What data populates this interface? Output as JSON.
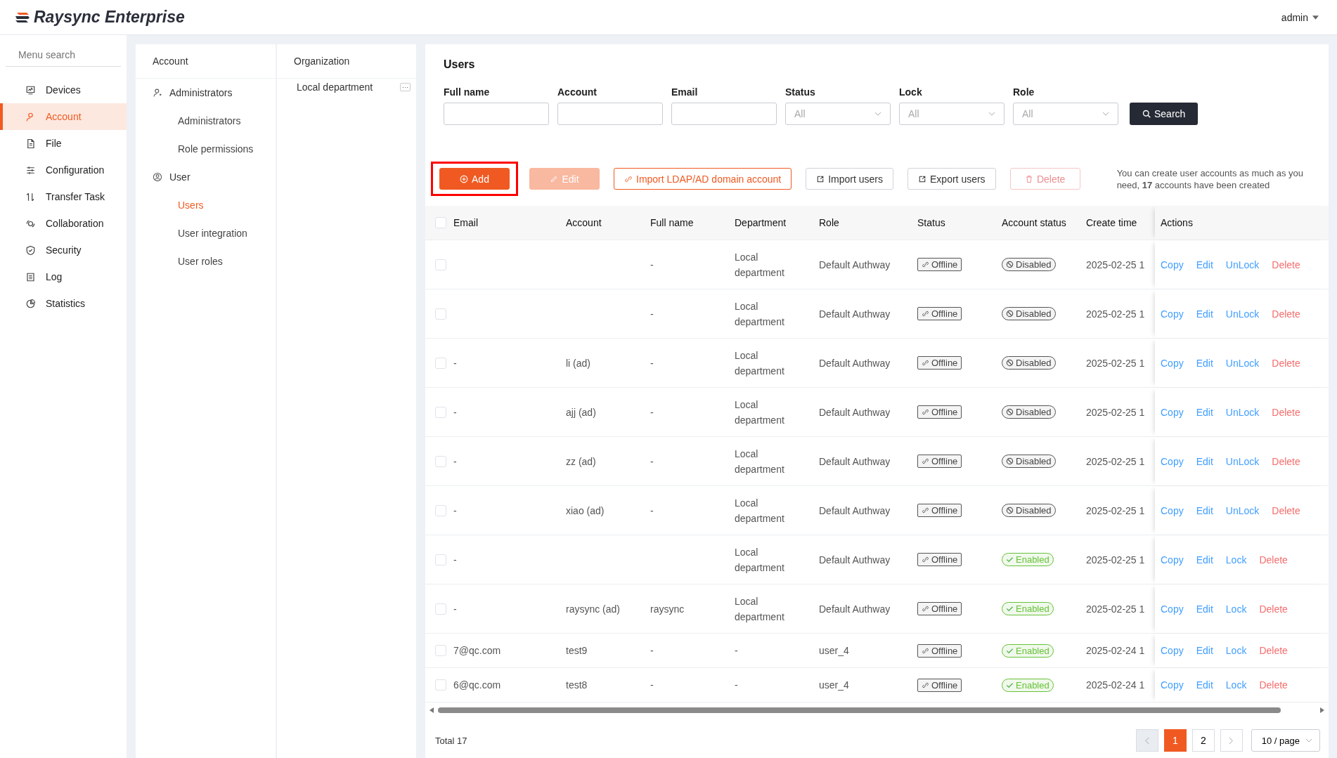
{
  "header": {
    "product": "Raysync Enterprise",
    "user": "admin"
  },
  "sidebar": {
    "search": {
      "placeholder": "Menu search"
    },
    "items": [
      {
        "label": "Devices",
        "selected": false
      },
      {
        "label": "Account",
        "selected": true
      },
      {
        "label": "File",
        "selected": false
      },
      {
        "label": "Configuration",
        "selected": false
      },
      {
        "label": "Transfer Task",
        "selected": false
      },
      {
        "label": "Collaboration",
        "selected": false
      },
      {
        "label": "Security",
        "selected": false
      },
      {
        "label": "Log",
        "selected": false
      },
      {
        "label": "Statistics",
        "selected": false
      }
    ]
  },
  "account_menu": {
    "title": "Account",
    "groups": [
      {
        "label": "Administrators",
        "children": [
          {
            "label": "Administrators",
            "selected": false
          },
          {
            "label": "Role permissions",
            "selected": false
          }
        ]
      },
      {
        "label": "User",
        "children": [
          {
            "label": "Users",
            "selected": true
          },
          {
            "label": "User integration",
            "selected": false
          },
          {
            "label": "User roles",
            "selected": false
          }
        ]
      }
    ]
  },
  "organization": {
    "title": "Organization",
    "items": [
      {
        "label": "Local department",
        "more": "···"
      }
    ]
  },
  "users": {
    "title": "Users",
    "filters": [
      {
        "label": "Full name",
        "kind": "text"
      },
      {
        "label": "Account",
        "kind": "text"
      },
      {
        "label": "Email",
        "kind": "text"
      },
      {
        "label": "Status",
        "kind": "select",
        "placeholder": "All"
      },
      {
        "label": "Lock",
        "kind": "select",
        "placeholder": "All"
      },
      {
        "label": "Role",
        "kind": "select",
        "placeholder": "All"
      }
    ],
    "search_button": "Search",
    "toolbar": [
      {
        "label": "Add",
        "kind": "primary",
        "disabled": false,
        "highlighted": true
      },
      {
        "label": "Edit",
        "kind": "primary",
        "disabled": true,
        "highlighted": false
      },
      {
        "label": "Import LDAP/AD domain account",
        "kind": "outline",
        "disabled": false,
        "highlighted": false
      },
      {
        "label": "Import users",
        "kind": "default",
        "disabled": false,
        "highlighted": false
      },
      {
        "label": "Export users",
        "kind": "default",
        "disabled": false,
        "highlighted": false
      },
      {
        "label": "Delete",
        "kind": "danger",
        "disabled": true,
        "highlighted": false
      }
    ],
    "notice": "You can create user accounts as much as you need, **17** accounts have been created",
    "table": {
      "select_all_checked": false,
      "columns": [
        "Email",
        "Account",
        "Full name",
        "Department",
        "Role",
        "Status",
        "Account status",
        "Create time",
        "Actions"
      ],
      "rows": [
        {
          "checked": false,
          "email": "",
          "account": "",
          "full_name": "-",
          "department": "Local department",
          "role": "Default Authway",
          "status": "Offline",
          "account_status": {
            "label": "Disabled",
            "kind": "disabled"
          },
          "create_time": "2025-02-25 1",
          "actions": [
            {
              "label": "Copy",
              "kind": "link"
            },
            {
              "label": "Edit",
              "kind": "link"
            },
            {
              "label": "UnLock",
              "kind": "link"
            },
            {
              "label": "Delete",
              "kind": "danger"
            }
          ]
        },
        {
          "checked": false,
          "email": "",
          "account": "",
          "full_name": "-",
          "department": "Local department",
          "role": "Default Authway",
          "status": "Offline",
          "account_status": {
            "label": "Disabled",
            "kind": "disabled"
          },
          "create_time": "2025-02-25 1",
          "actions": [
            {
              "label": "Copy",
              "kind": "link"
            },
            {
              "label": "Edit",
              "kind": "link"
            },
            {
              "label": "UnLock",
              "kind": "link"
            },
            {
              "label": "Delete",
              "kind": "danger"
            }
          ]
        },
        {
          "checked": false,
          "email": "-",
          "account": "li (ad)",
          "full_name": "-",
          "department": "Local department",
          "role": "Default Authway",
          "status": "Offline",
          "account_status": {
            "label": "Disabled",
            "kind": "disabled"
          },
          "create_time": "2025-02-25 1",
          "actions": [
            {
              "label": "Copy",
              "kind": "link"
            },
            {
              "label": "Edit",
              "kind": "link"
            },
            {
              "label": "UnLock",
              "kind": "link"
            },
            {
              "label": "Delete",
              "kind": "danger"
            }
          ]
        },
        {
          "checked": false,
          "email": "-",
          "account": "ajj (ad)",
          "full_name": "-",
          "department": "Local department",
          "role": "Default Authway",
          "status": "Offline",
          "account_status": {
            "label": "Disabled",
            "kind": "disabled"
          },
          "create_time": "2025-02-25 1",
          "actions": [
            {
              "label": "Copy",
              "kind": "link"
            },
            {
              "label": "Edit",
              "kind": "link"
            },
            {
              "label": "UnLock",
              "kind": "link"
            },
            {
              "label": "Delete",
              "kind": "danger"
            }
          ]
        },
        {
          "checked": false,
          "email": "-",
          "account": "zz (ad)",
          "full_name": "-",
          "department": "Local department",
          "role": "Default Authway",
          "status": "Offline",
          "account_status": {
            "label": "Disabled",
            "kind": "disabled"
          },
          "create_time": "2025-02-25 1",
          "actions": [
            {
              "label": "Copy",
              "kind": "link"
            },
            {
              "label": "Edit",
              "kind": "link"
            },
            {
              "label": "UnLock",
              "kind": "link"
            },
            {
              "label": "Delete",
              "kind": "danger"
            }
          ]
        },
        {
          "checked": false,
          "email": "-",
          "account": "xiao (ad)",
          "full_name": "-",
          "department": "Local department",
          "role": "Default Authway",
          "status": "Offline",
          "account_status": {
            "label": "Disabled",
            "kind": "disabled"
          },
          "create_time": "2025-02-25 1",
          "actions": [
            {
              "label": "Copy",
              "kind": "link"
            },
            {
              "label": "Edit",
              "kind": "link"
            },
            {
              "label": "UnLock",
              "kind": "link"
            },
            {
              "label": "Delete",
              "kind": "danger"
            }
          ]
        },
        {
          "checked": false,
          "email": "-",
          "account": "",
          "full_name": "",
          "department": "Local department",
          "role": "Default Authway",
          "status": "Offline",
          "account_status": {
            "label": "Enabled",
            "kind": "enabled"
          },
          "create_time": "2025-02-25 1",
          "actions": [
            {
              "label": "Copy",
              "kind": "link"
            },
            {
              "label": "Edit",
              "kind": "link"
            },
            {
              "label": "Lock",
              "kind": "link"
            },
            {
              "label": "Delete",
              "kind": "danger"
            }
          ]
        },
        {
          "checked": false,
          "email": "-",
          "account": "raysync (ad)",
          "full_name": "raysync",
          "department": "Local department",
          "role": "Default Authway",
          "status": "Offline",
          "account_status": {
            "label": "Enabled",
            "kind": "enabled"
          },
          "create_time": "2025-02-25 1",
          "actions": [
            {
              "label": "Copy",
              "kind": "link"
            },
            {
              "label": "Edit",
              "kind": "link"
            },
            {
              "label": "Lock",
              "kind": "link"
            },
            {
              "label": "Delete",
              "kind": "danger"
            }
          ]
        },
        {
          "checked": false,
          "email": "7@qc.com",
          "account": "test9",
          "full_name": "-",
          "department": "-",
          "role": "user_4",
          "status": "Offline",
          "account_status": {
            "label": "Enabled",
            "kind": "enabled"
          },
          "create_time": "2025-02-24 1",
          "actions": [
            {
              "label": "Copy",
              "kind": "link"
            },
            {
              "label": "Edit",
              "kind": "link"
            },
            {
              "label": "Lock",
              "kind": "link"
            },
            {
              "label": "Delete",
              "kind": "danger"
            }
          ]
        },
        {
          "checked": false,
          "email": "6@qc.com",
          "account": "test8",
          "full_name": "-",
          "department": "-",
          "role": "user_4",
          "status": "Offline",
          "account_status": {
            "label": "Enabled",
            "kind": "enabled"
          },
          "create_time": "2025-02-24 1",
          "actions": [
            {
              "label": "Copy",
              "kind": "link"
            },
            {
              "label": "Edit",
              "kind": "link"
            },
            {
              "label": "Lock",
              "kind": "link"
            },
            {
              "label": "Delete",
              "kind": "danger"
            }
          ]
        }
      ]
    },
    "footer": {
      "total": "Total 17",
      "pages": [
        {
          "label": "1",
          "selected": true
        },
        {
          "label": "2",
          "selected": false
        }
      ],
      "prev_disabled": true,
      "page_size": "10 / page"
    }
  }
}
